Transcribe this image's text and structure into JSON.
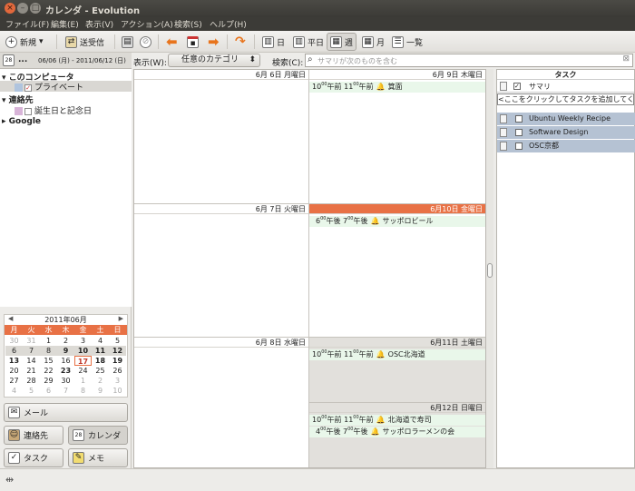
{
  "window": {
    "title": "カレンダ - Evolution"
  },
  "menu": [
    "ファイル(F)",
    "編集(E)",
    "表示(V)",
    "アクション(A)",
    "検索(S)",
    "ヘルプ(H)"
  ],
  "toolbar": {
    "new_label": "新規",
    "sendrecv_label": "送受信",
    "day_label": "日",
    "workweek_label": "平日",
    "week_label": "週",
    "month_label": "月",
    "list_label": "一覧"
  },
  "date_header": {
    "dots": "...",
    "range": "06/06 (月) - 2011/06/12 (日)"
  },
  "sources": {
    "group1": "このコンピュータ",
    "item1": "プライベート",
    "group2": "連絡先",
    "item2": "誕生日と記念日",
    "group3": "Google"
  },
  "mini_calendar": {
    "title": "2011年06月",
    "weekdays": [
      "月",
      "火",
      "水",
      "木",
      "金",
      "土",
      "日"
    ],
    "weeks": [
      [
        "30",
        "31",
        "1",
        "2",
        "3",
        "4",
        "5"
      ],
      [
        "6",
        "7",
        "8",
        "9",
        "10",
        "11",
        "12"
      ],
      [
        "13",
        "14",
        "15",
        "16",
        "17",
        "18",
        "19"
      ],
      [
        "20",
        "21",
        "22",
        "23",
        "24",
        "25",
        "26"
      ],
      [
        "27",
        "28",
        "29",
        "30",
        "1",
        "2",
        "3"
      ],
      [
        "4",
        "5",
        "6",
        "7",
        "8",
        "9",
        "10"
      ]
    ]
  },
  "switcher": {
    "mail": "メール",
    "contacts": "連絡先",
    "calendar": "カレンダ",
    "tasks": "タスク",
    "memos": "メモ"
  },
  "filter": {
    "show_label": "表示(W):",
    "category": "任意のカテゴリ",
    "search_label": "検索(C):",
    "search_placeholder": "サマリが次のものを含む"
  },
  "days": {
    "mon": "6月 6日 月曜日",
    "tue": "6月 7日 火曜日",
    "wed": "6月 8日 水曜日",
    "thu": "6月 9日 木曜日",
    "fri": "6月10日 金曜日",
    "sat": "6月11日 土曜日",
    "sun": "6月12日 日曜日"
  },
  "events": {
    "thu1": {
      "t1": "10",
      "t1s": "00",
      "ap1": "午前 ",
      "t2": "11",
      "t2s": "00",
      "ap2": "午前",
      "title": "箕面"
    },
    "fri1": {
      "t1": "6",
      "t1s": "00",
      "ap1": "午後 ",
      "t2": "7",
      "t2s": "00",
      "ap2": "午後",
      "title": "サッポロビール"
    },
    "sat1": {
      "t1": "10",
      "t1s": "00",
      "ap1": "午前 ",
      "t2": "11",
      "t2s": "00",
      "ap2": "午前",
      "title": "OSC北海道"
    },
    "sun1": {
      "t1": "10",
      "t1s": "00",
      "ap1": "午前 ",
      "t2": "11",
      "t2s": "00",
      "ap2": "午前",
      "title": "北海道で寿司"
    },
    "sun2": {
      "t1": "4",
      "t1s": "00",
      "ap1": "午後 ",
      "t2": "7",
      "t2s": "00",
      "ap2": "午後",
      "title": "サッポロラーメンの会"
    }
  },
  "tasks": {
    "title": "タスク",
    "column": "サマリ",
    "add_hint": "<ここをクリックしてタスクを追加してくだ",
    "items": [
      "Ubuntu Weekly Recipe",
      "Software Design",
      "OSC京都"
    ]
  },
  "colors": {
    "accent": "#e87145",
    "event_bg": "#e9f7ea",
    "task_sel": "#b5c2d3"
  }
}
